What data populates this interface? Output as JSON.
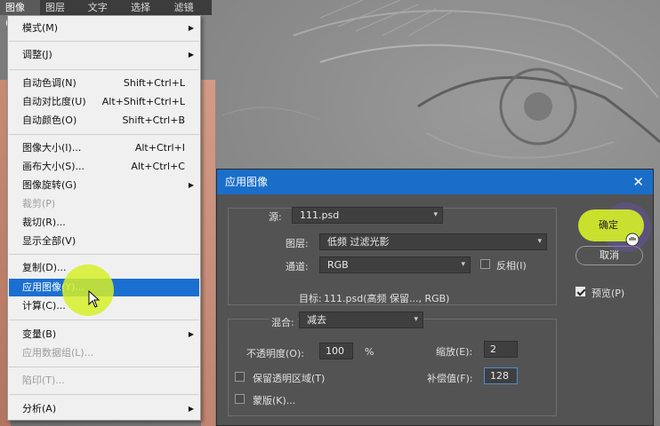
{
  "menubar": {
    "items": [
      "图像(I)",
      "图层(L)",
      "文字(Y)",
      "选择(S)",
      "滤镜(T)"
    ]
  },
  "image_menu": {
    "items": [
      {
        "label": "模式(M)",
        "submenu": true
      },
      {
        "label": "调整(J)",
        "submenu": true
      },
      {
        "label": "自动色调(N)",
        "shortcut": "Shift+Ctrl+L"
      },
      {
        "label": "自动对比度(U)",
        "shortcut": "Alt+Shift+Ctrl+L"
      },
      {
        "label": "自动颜色(O)",
        "shortcut": "Shift+Ctrl+B"
      },
      {
        "label": "图像大小(I)...",
        "shortcut": "Alt+Ctrl+I"
      },
      {
        "label": "画布大小(S)...",
        "shortcut": "Alt+Ctrl+C"
      },
      {
        "label": "图像旋转(G)",
        "submenu": true
      },
      {
        "label": "裁剪(P)",
        "disabled": true
      },
      {
        "label": "裁切(R)..."
      },
      {
        "label": "显示全部(V)"
      },
      {
        "label": "复制(D)..."
      },
      {
        "label": "应用图像(Y)...",
        "highlighted": true
      },
      {
        "label": "计算(C)..."
      },
      {
        "label": "变量(B)",
        "submenu": true
      },
      {
        "label": "应用数据组(L)...",
        "disabled": true
      },
      {
        "label": "陷印(T)...",
        "disabled": true
      },
      {
        "label": "分析(A)",
        "submenu": true
      }
    ]
  },
  "dialog": {
    "title": "应用图像",
    "source_label": "源:",
    "source_value": "111.psd",
    "layer_label": "图层:",
    "layer_value": "低频 过滤光影",
    "channel_label": "通道:",
    "channel_value": "RGB",
    "invert_label": "反相(I)",
    "target_label": "目标:",
    "target_value": "111.psd(高频 保留..., RGB)",
    "blend_label": "混合:",
    "blend_value": "减去",
    "opacity_label": "不透明度(O):",
    "opacity_value": "100",
    "opacity_unit": "%",
    "scale_label": "缩放(E):",
    "scale_value": "2",
    "offset_label": "补偿值(F):",
    "offset_value": "128",
    "preserve_label": "保留透明区域(T)",
    "mask_label": "蒙版(K)...",
    "ok_label": "确定",
    "cancel_label": "取消",
    "preview_label": "预览(P)"
  },
  "colors": {
    "highlight": "#1b6fd0",
    "title_bar": "#1a6ec9",
    "cursor_glow": "#d6f028"
  }
}
